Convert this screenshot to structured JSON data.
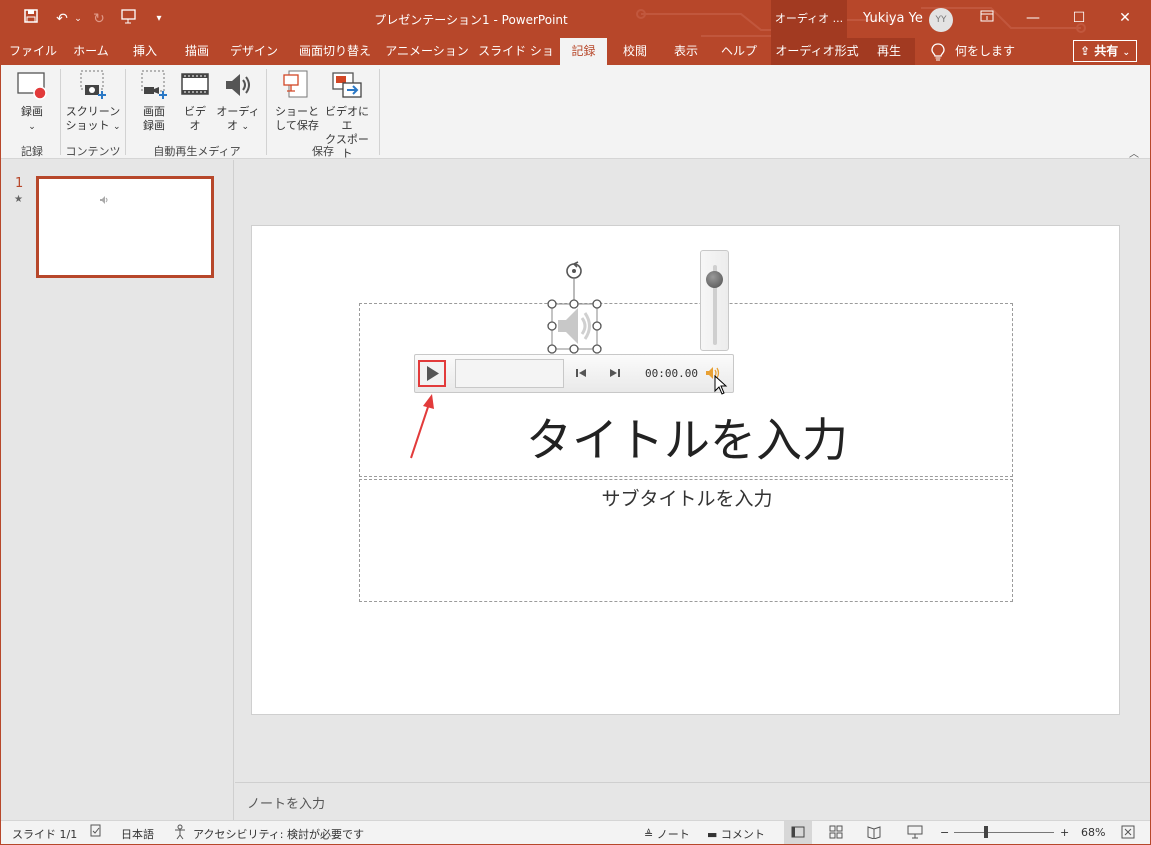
{
  "window": {
    "title": "プレゼンテーション1 - PowerPoint",
    "contextual_tab_header": "オーディオ ...",
    "user_name": "Yukiya Ye",
    "user_initials": "YY"
  },
  "tabs": [
    {
      "label": "ファイル"
    },
    {
      "label": "ホーム"
    },
    {
      "label": "挿入"
    },
    {
      "label": "描画"
    },
    {
      "label": "デザイン"
    },
    {
      "label": "画面切り替え"
    },
    {
      "label": "アニメーション"
    },
    {
      "label": "スライド ショー"
    },
    {
      "label": "記録"
    },
    {
      "label": "校閲"
    },
    {
      "label": "表示"
    },
    {
      "label": "ヘルプ"
    },
    {
      "label": "オーディオ形式"
    },
    {
      "label": "再生"
    }
  ],
  "active_tab": "記録",
  "tell_me": "何をしますか",
  "share_label": "共有",
  "ribbon": {
    "record": {
      "line1": "録画",
      "group": "記録"
    },
    "screenshot": {
      "line1": "スクリーン",
      "line2": "ショット",
      "group": "コンテンツ"
    },
    "screen_recording": {
      "line1": "画面",
      "line2": "録画"
    },
    "video": {
      "line1": "ビデ",
      "line2": "オ"
    },
    "audio": {
      "line1": "オーディ",
      "line2": "オ"
    },
    "automedia_group": "自動再生メディア",
    "save_as_show": {
      "line1": "ショーと",
      "line2": "して保存"
    },
    "export_video": {
      "line1": "ビデオにエ",
      "line2": "クスポート"
    },
    "save_group": "保存"
  },
  "thumbnails": {
    "slide_number": "1",
    "anim_marker": "★"
  },
  "slide": {
    "title_placeholder": "タイトルを入力",
    "subtitle_placeholder": "サブタイトルを入力"
  },
  "player": {
    "time": "00:00.00"
  },
  "notes_placeholder": "ノートを入力",
  "status": {
    "slide_indicator": "スライド 1/1",
    "language": "日本語",
    "accessibility": "アクセシビリティ: 検討が必要です",
    "notes_label": "ノート",
    "comments_label": "コメント",
    "zoom_percent": "68%",
    "zoom_level": 0.68
  },
  "colors": {
    "accent": "#b7472a",
    "arrow": "#e23b3b"
  }
}
